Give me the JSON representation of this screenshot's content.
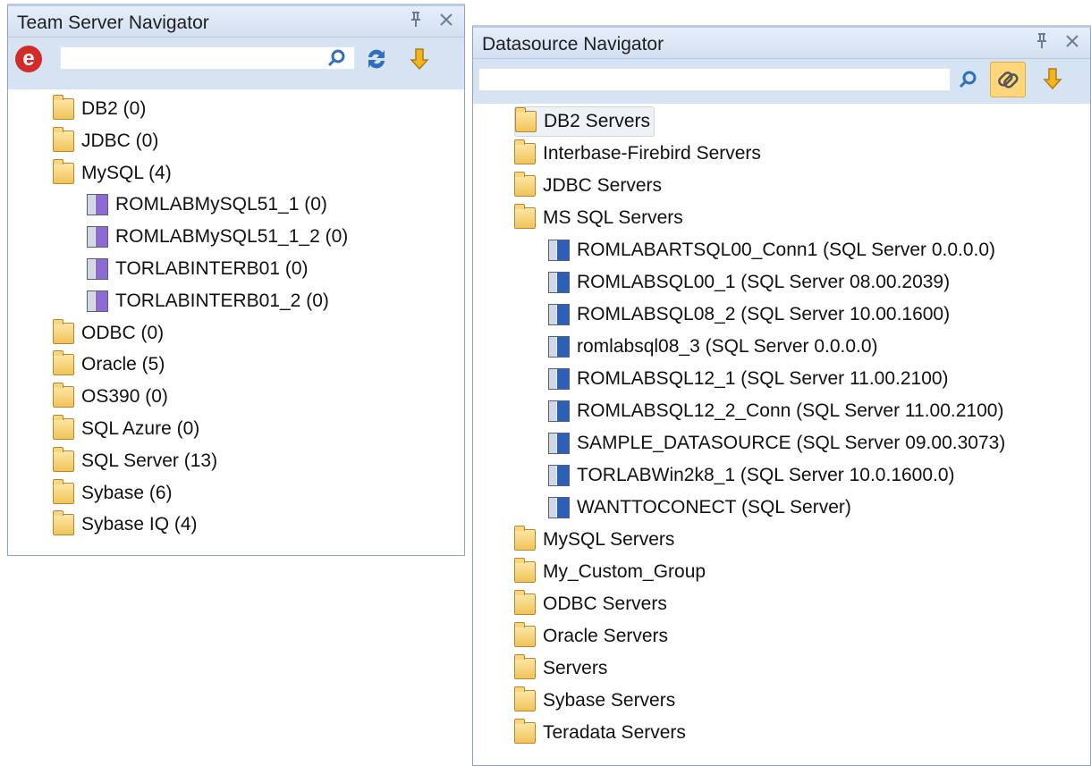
{
  "team_panel": {
    "title": "Team Server Navigator",
    "pin_glyph": "ᵖ",
    "close_glyph": "✕",
    "logo_letter": "e",
    "search": {
      "value": "",
      "placeholder": ""
    },
    "icons": [
      "e-logo-icon",
      "search-icon",
      "refresh-icon",
      "arrow-down-icon"
    ],
    "tree": [
      {
        "label": "DB2 (0)",
        "icon": "folder-icon",
        "level": 0
      },
      {
        "label": "JDBC (0)",
        "icon": "folder-icon",
        "level": 0
      },
      {
        "label": "MySQL (4)",
        "icon": "folder-icon",
        "level": 0
      },
      {
        "label": "ROMLABMySQL51_1 (0)",
        "icon": "server-icon",
        "level": 1
      },
      {
        "label": "ROMLABMySQL51_1_2 (0)",
        "icon": "server-icon",
        "level": 1
      },
      {
        "label": "TORLABINTERB01 (0)",
        "icon": "server-icon",
        "level": 1
      },
      {
        "label": "TORLABINTERB01_2 (0)",
        "icon": "server-icon",
        "level": 1
      },
      {
        "label": "ODBC (0)",
        "icon": "folder-icon",
        "level": 0
      },
      {
        "label": "Oracle (5)",
        "icon": "folder-icon",
        "level": 0
      },
      {
        "label": "OS390 (0)",
        "icon": "folder-icon",
        "level": 0
      },
      {
        "label": "SQL Azure (0)",
        "icon": "folder-icon",
        "level": 0
      },
      {
        "label": "SQL Server (13)",
        "icon": "folder-icon",
        "level": 0
      },
      {
        "label": "Sybase (6)",
        "icon": "folder-icon",
        "level": 0
      },
      {
        "label": "Sybase IQ (4)",
        "icon": "folder-icon",
        "level": 0
      }
    ]
  },
  "ds_panel": {
    "title": "Datasource Navigator",
    "search": {
      "value": "",
      "placeholder": ""
    },
    "icons": [
      "search-icon",
      "link-icon",
      "arrow-down-icon"
    ],
    "selected_index": 0,
    "tree": [
      {
        "label": "DB2 Servers",
        "icon": "folder-icon",
        "level": 0
      },
      {
        "label": "Interbase-Firebird Servers",
        "icon": "folder-icon",
        "level": 0
      },
      {
        "label": "JDBC Servers",
        "icon": "folder-icon",
        "level": 0
      },
      {
        "label": "MS SQL Servers",
        "icon": "folder-icon",
        "level": 0
      },
      {
        "label": "ROMLABARTSQL00_Conn1 (SQL Server 0.0.0.0)",
        "icon": "server-icon",
        "level": 1
      },
      {
        "label": "ROMLABSQL00_1 (SQL Server 08.00.2039)",
        "icon": "server-icon",
        "level": 1
      },
      {
        "label": "ROMLABSQL08_2 (SQL Server 10.00.1600)",
        "icon": "server-icon",
        "level": 1
      },
      {
        "label": "romlabsql08_3 (SQL Server 0.0.0.0)",
        "icon": "server-icon",
        "level": 1
      },
      {
        "label": "ROMLABSQL12_1 (SQL Server 11.00.2100)",
        "icon": "server-icon",
        "level": 1
      },
      {
        "label": "ROMLABSQL12_2_Conn (SQL Server 11.00.2100)",
        "icon": "server-icon",
        "level": 1
      },
      {
        "label": "SAMPLE_DATASOURCE (SQL Server 09.00.3073)",
        "icon": "server-icon",
        "level": 1
      },
      {
        "label": "TORLABWin2k8_1 (SQL Server 10.0.1600.0)",
        "icon": "server-icon",
        "level": 1
      },
      {
        "label": "WANTTOCONECT (SQL Server)",
        "icon": "server-icon",
        "level": 1
      },
      {
        "label": "MySQL Servers",
        "icon": "folder-icon",
        "level": 0
      },
      {
        "label": "My_Custom_Group",
        "icon": "folder-icon",
        "level": 0
      },
      {
        "label": "ODBC Servers",
        "icon": "folder-icon",
        "level": 0
      },
      {
        "label": "Oracle Servers",
        "icon": "folder-icon",
        "level": 0
      },
      {
        "label": "Servers",
        "icon": "folder-icon",
        "level": 0
      },
      {
        "label": "Sybase Servers",
        "icon": "folder-icon",
        "level": 0
      },
      {
        "label": "Teradata Servers",
        "icon": "folder-icon",
        "level": 0
      }
    ]
  },
  "colors": {
    "panel_border": "#8da3c1",
    "toolbar_bg": "#d6e3f3",
    "folder": "#f1c35a",
    "mysql_server": "#8c6bd3",
    "mssql_server": "#2b5fb8",
    "logo_red": "#d32a2a",
    "highlight": "#ffd77a"
  }
}
